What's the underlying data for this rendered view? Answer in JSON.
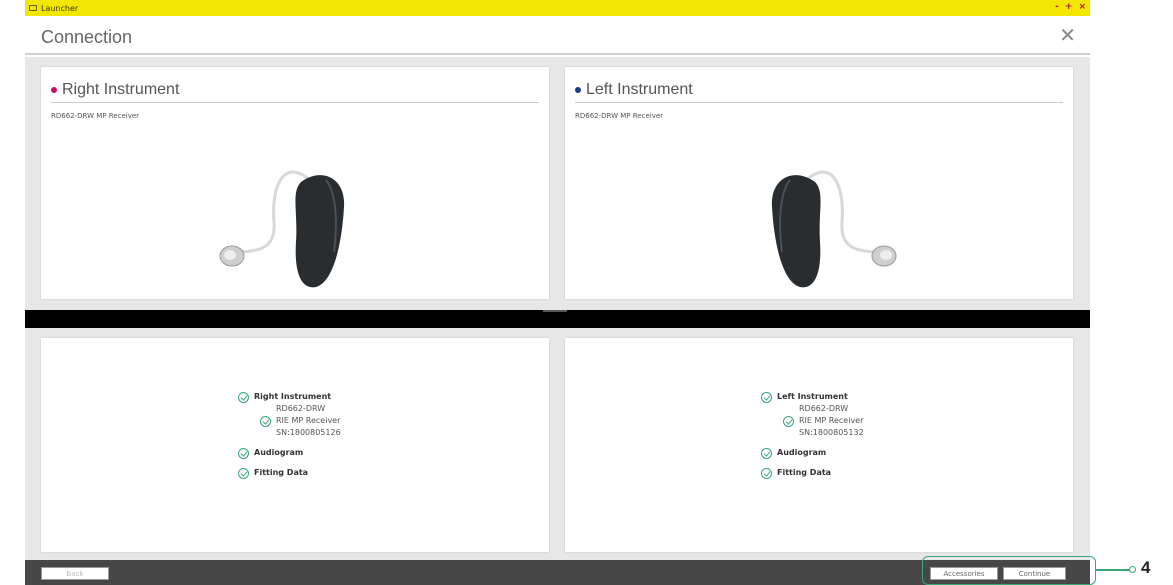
{
  "window": {
    "app_name": "Launcher",
    "controls": [
      "-",
      "+",
      "×"
    ]
  },
  "header": {
    "title": "Connection",
    "close_symbol": "✕"
  },
  "instruments": {
    "right": {
      "title": "Right Instrument",
      "model": "RD662-DRW MP Receiver",
      "dot_color": "#c4105a"
    },
    "left": {
      "title": "Left Instrument",
      "model": "RD662-DRW MP Receiver",
      "dot_color": "#1e3a8a"
    }
  },
  "status": {
    "right": {
      "title": "Right Instrument",
      "device": "RD662-DRW",
      "receiver": "RIE MP Receiver",
      "serial": "SN:1800805126",
      "audiogram": "Audiogram",
      "fitting": "Fitting Data"
    },
    "left": {
      "title": "Left Instrument",
      "device": "RD662-DRW",
      "receiver": "RIE MP Receiver",
      "serial": "SN:1800805132",
      "audiogram": "Audiogram",
      "fitting": "Fitting Data"
    }
  },
  "footer": {
    "back_label": "Back",
    "accessories_label": "Accessories",
    "continue_label": "Continue"
  },
  "callout": {
    "number": "4"
  },
  "colors": {
    "titlebar": "#f3e600",
    "check": "#3aa676",
    "footer": "#474747"
  }
}
